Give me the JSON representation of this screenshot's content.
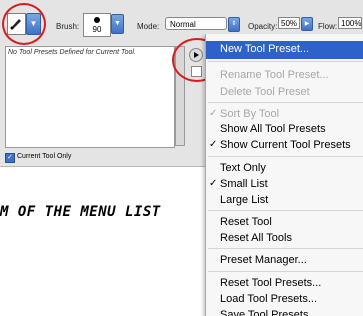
{
  "options_bar": {
    "brush_label": "Brush:",
    "brush_size": "90",
    "mode_label": "Mode:",
    "mode_value": "Normal",
    "opacity_label": "Opacity:",
    "opacity_value": "50%",
    "flow_label": "Flow:",
    "flow_value": "100%"
  },
  "preset_panel": {
    "empty_message": "No Tool Presets Defined for Current Tool.",
    "current_tool_only_label": "Current Tool Only",
    "current_tool_only_checked": true
  },
  "caption": {
    "text": "M OF THE MENU LIST"
  },
  "menu": {
    "items": [
      {
        "label": "New Tool Preset...",
        "state": "selected",
        "checked": false
      },
      {
        "label": "Rename Tool Preset...",
        "state": "disabled",
        "checked": false
      },
      {
        "label": "Delete Tool Preset",
        "state": "disabled",
        "checked": false
      },
      {
        "label": "Sort By Tool",
        "state": "disabled",
        "checked": true
      },
      {
        "label": "Show All Tool Presets",
        "state": "enabled",
        "checked": false
      },
      {
        "label": "Show Current Tool Presets",
        "state": "enabled",
        "checked": true
      },
      {
        "label": "Text Only",
        "state": "enabled",
        "checked": false
      },
      {
        "label": "Small List",
        "state": "enabled",
        "checked": true
      },
      {
        "label": "Large List",
        "state": "enabled",
        "checked": false
      },
      {
        "label": "Reset Tool",
        "state": "enabled",
        "checked": false
      },
      {
        "label": "Reset All Tools",
        "state": "enabled",
        "checked": false
      },
      {
        "label": "Preset Manager...",
        "state": "enabled",
        "checked": false
      },
      {
        "label": "Reset Tool Presets...",
        "state": "enabled",
        "checked": false
      },
      {
        "label": "Load Tool Presets...",
        "state": "enabled",
        "checked": false
      },
      {
        "label": "Save Tool Presets...",
        "state": "enabled",
        "checked": false
      }
    ],
    "check_glyph": "✓"
  },
  "colors": {
    "highlight": "#2d63c9",
    "annotation_circle": "#d61e1e"
  }
}
